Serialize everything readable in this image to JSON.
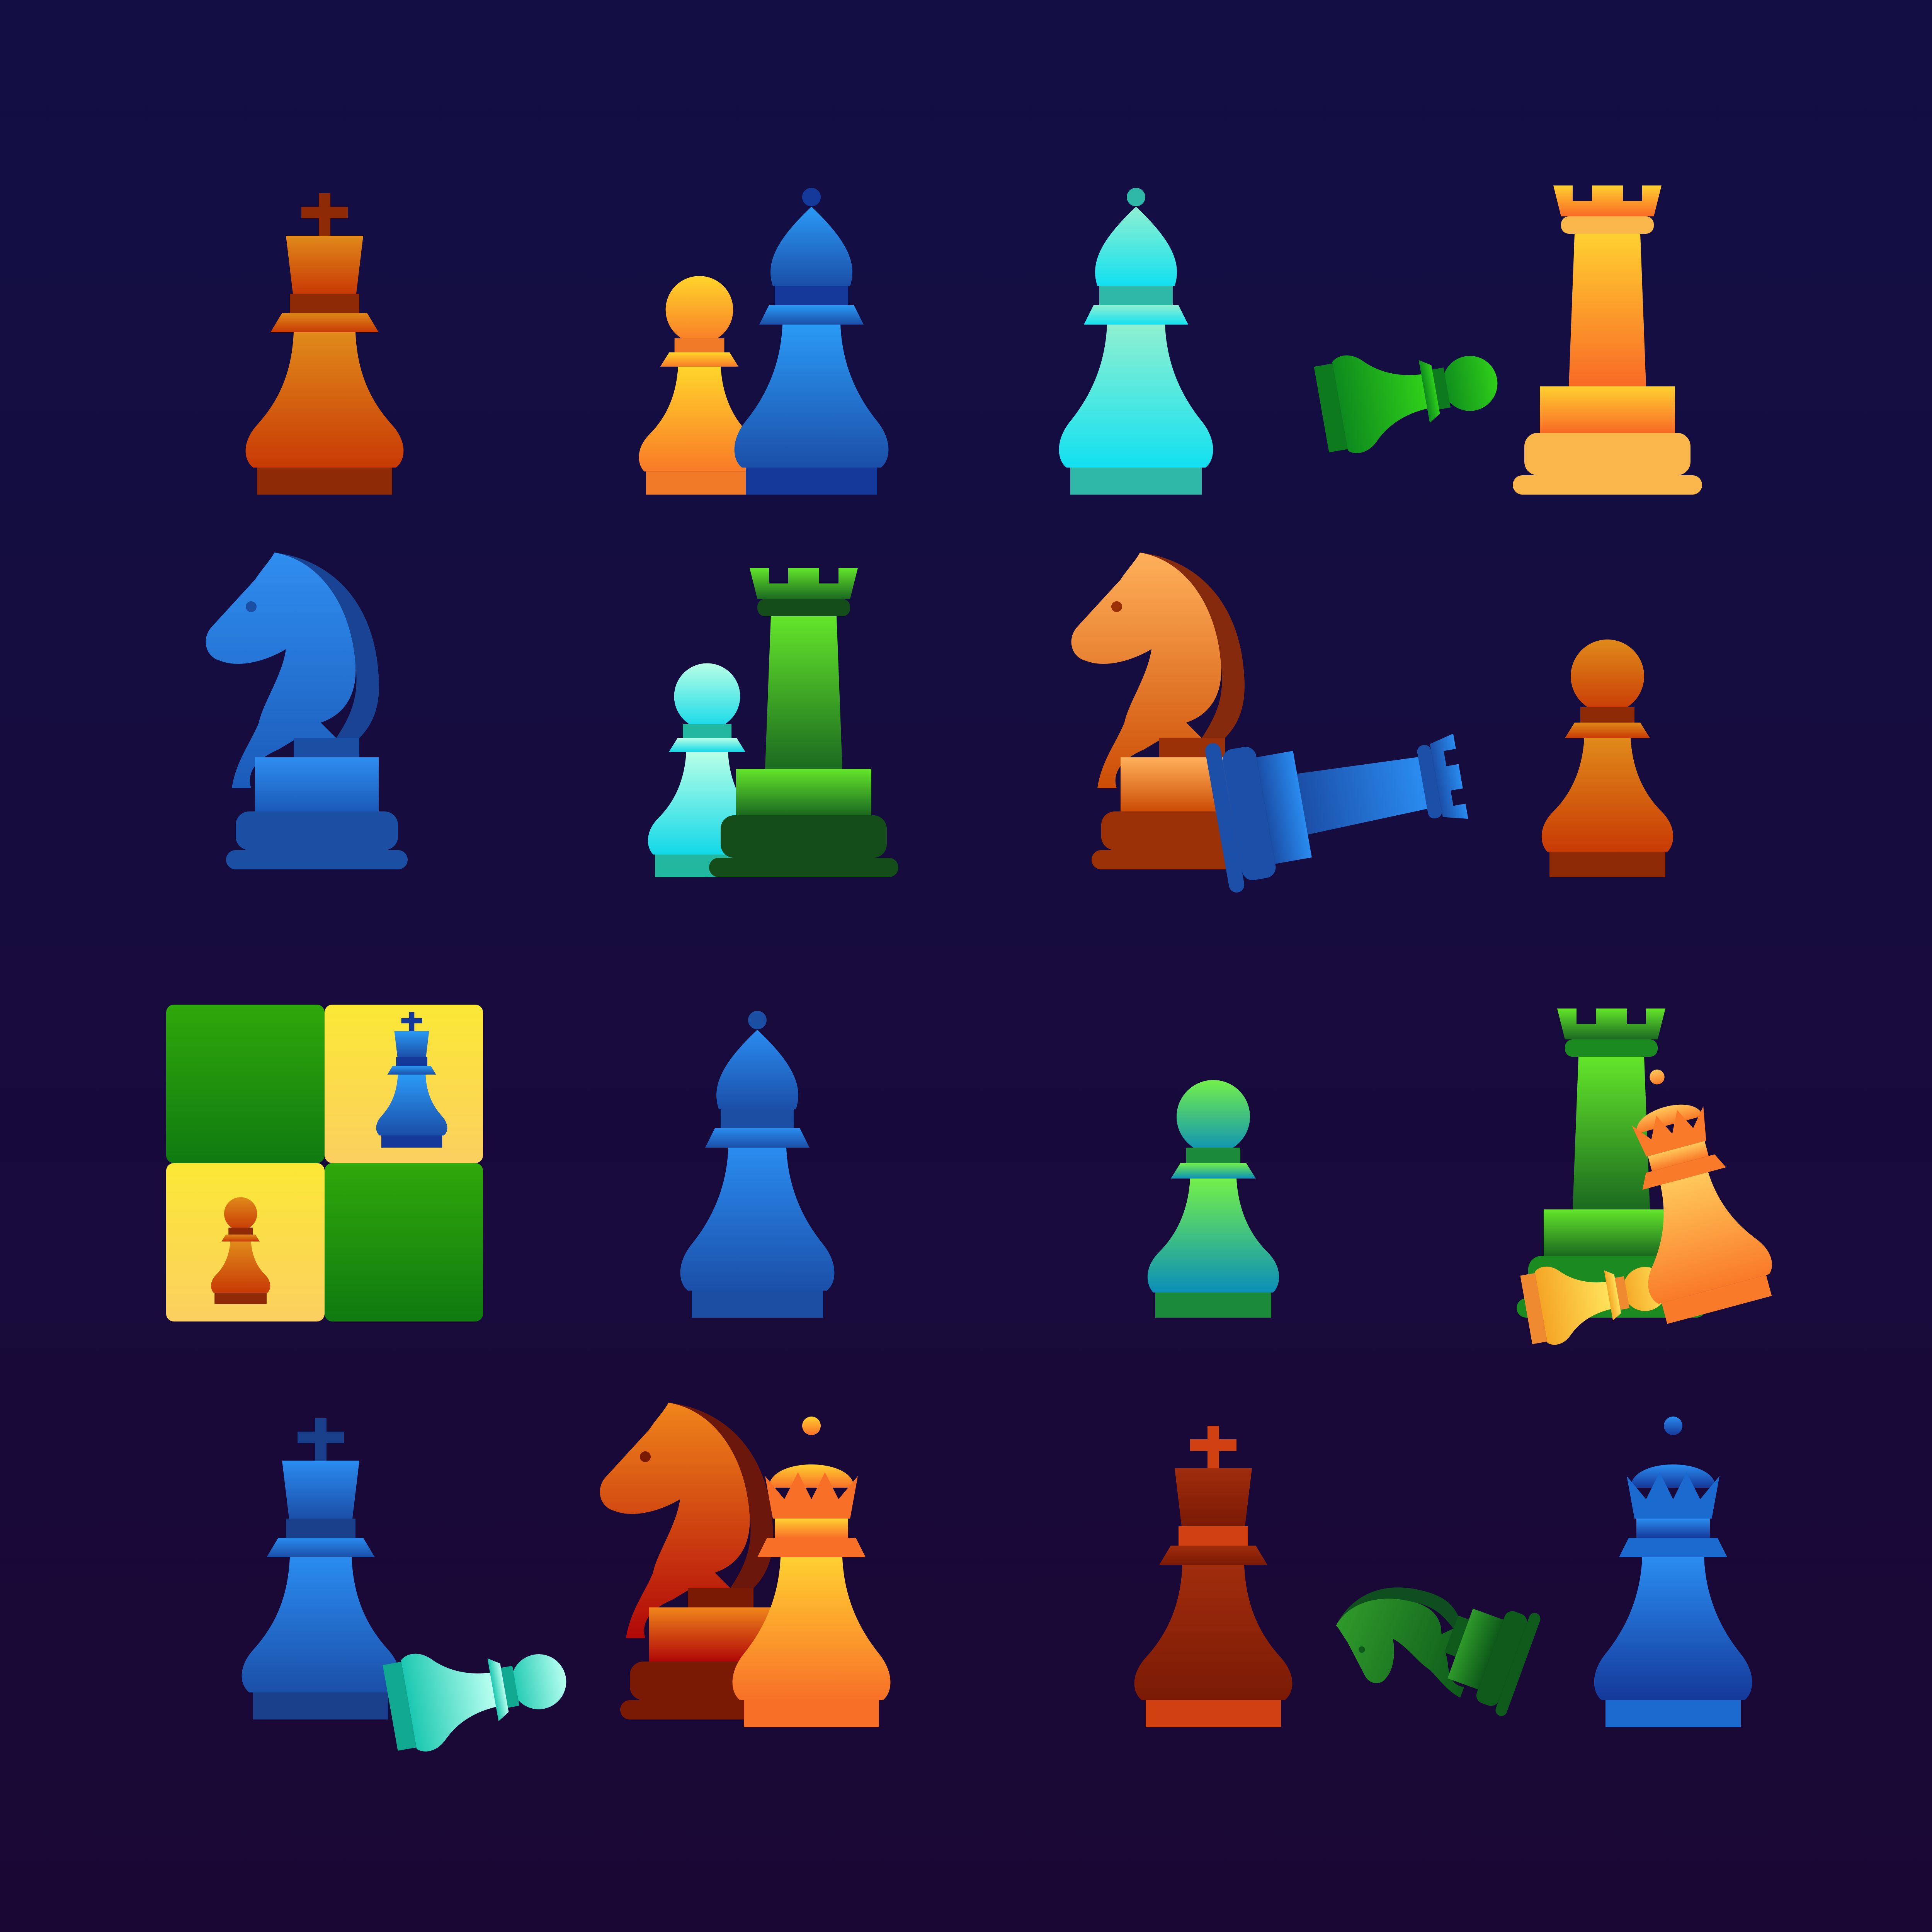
{
  "background": {
    "top": "#120f45",
    "bottom": "#1b0734"
  },
  "icons": [
    {
      "name": "king-icon",
      "pieces": [
        {
          "piece": "king",
          "colors": [
            "#e08a1a",
            "#c83a05"
          ],
          "base": "#8e2a05"
        }
      ]
    },
    {
      "name": "pawn-and-bishop-icon",
      "pieces": [
        {
          "piece": "pawn",
          "colors": [
            "#ffd52a",
            "#f97a28"
          ],
          "base": "#f07a28"
        },
        {
          "piece": "bishop",
          "colors": [
            "#2a9af5",
            "#1b4fa8"
          ],
          "base": "#14399a"
        }
      ]
    },
    {
      "name": "bishop-toppling-pawn-icon",
      "pieces": [
        {
          "piece": "bishop",
          "colors": [
            "#8ff0d0",
            "#12e0f0"
          ],
          "base": "#2fb8a8"
        },
        {
          "piece": "fallen-pawn",
          "colors": [
            "#2fcf1a",
            "#0e8a1e"
          ],
          "base": "#0e7a1e"
        }
      ]
    },
    {
      "name": "rook-icon",
      "pieces": [
        {
          "piece": "rook",
          "colors": [
            "#ffd030",
            "#f86a25"
          ],
          "base": "#f9b64a"
        }
      ]
    },
    {
      "name": "knight-icon",
      "pieces": [
        {
          "piece": "knight",
          "colors": [
            "#2f8ef0",
            "#1b5ab8"
          ],
          "base": "#1a4fa3"
        }
      ]
    },
    {
      "name": "pawn-and-rook-icon",
      "pieces": [
        {
          "piece": "pawn",
          "colors": [
            "#b8ffe6",
            "#12d8e8"
          ],
          "base": "#22b8a0"
        },
        {
          "piece": "rook",
          "colors": [
            "#63e52a",
            "#1b6a20"
          ],
          "base": "#144c1a"
        }
      ]
    },
    {
      "name": "knight-toppling-rook-icon",
      "pieces": [
        {
          "piece": "knight",
          "colors": [
            "#ffb05a",
            "#cc4d05"
          ],
          "base": "#9a3005"
        },
        {
          "piece": "fallen-rook",
          "colors": [
            "#2a8cf0",
            "#1b4fa8"
          ],
          "base": "#1b4fa8"
        }
      ]
    },
    {
      "name": "pawn-icon",
      "pieces": [
        {
          "piece": "pawn",
          "colors": [
            "#e08a1a",
            "#c83a05"
          ],
          "base": "#8e2a05"
        }
      ]
    },
    {
      "name": "chessboard-icon",
      "board": {
        "light": [
          "#fbe835",
          "#fbcf60"
        ],
        "dark": [
          "#2fa80a",
          "#0f7a10"
        ]
      },
      "pieces": [
        {
          "piece": "king",
          "colors": [
            "#2a9af5",
            "#1b4fa8"
          ],
          "base": "#14399a"
        },
        {
          "piece": "pawn",
          "colors": [
            "#e08a1a",
            "#c83a05"
          ],
          "base": "#8e2a05"
        }
      ]
    },
    {
      "name": "bishop-icon",
      "pieces": [
        {
          "piece": "bishop",
          "colors": [
            "#2a8cf0",
            "#1b4fa8"
          ],
          "base": "#1a4fa3"
        }
      ]
    },
    {
      "name": "pawn-icon",
      "pieces": [
        {
          "piece": "pawn",
          "colors": [
            "#74f04a",
            "#0b8fb8"
          ],
          "base": "#1b8a3a"
        }
      ]
    },
    {
      "name": "rook-and-fallen-pieces-icon",
      "pieces": [
        {
          "piece": "rook",
          "colors": [
            "#63e52a",
            "#1b6a20"
          ],
          "base": "#1b8a20"
        },
        {
          "piece": "fallen-pawn",
          "colors": [
            "#ffe25a",
            "#f5a525"
          ],
          "base": "#f08a30"
        },
        {
          "piece": "fallen-queen",
          "colors": [
            "#ffc85a",
            "#f97a28"
          ],
          "base": "#f97a28"
        }
      ]
    },
    {
      "name": "king-toppling-pawn-icon",
      "pieces": [
        {
          "piece": "king",
          "colors": [
            "#2a8cf0",
            "#1b4fa8"
          ],
          "base": "#1a3f8a"
        },
        {
          "piece": "fallen-pawn",
          "colors": [
            "#b8fff0",
            "#1cc8b0"
          ],
          "base": "#10a890"
        }
      ]
    },
    {
      "name": "knight-and-queen-icon",
      "pieces": [
        {
          "piece": "knight",
          "colors": [
            "#f0851a",
            "#b00808"
          ],
          "base": "#7a1a05"
        },
        {
          "piece": "queen",
          "colors": [
            "#ffd030",
            "#f87028"
          ],
          "base": "#f87028"
        }
      ]
    },
    {
      "name": "king-icon",
      "pieces": [
        {
          "piece": "king",
          "colors": [
            "#a02d0c",
            "#7a1a05"
          ],
          "base": "#d04010"
        }
      ]
    },
    {
      "name": "queen-and-fallen-knight-icon",
      "pieces": [
        {
          "piece": "queen",
          "colors": [
            "#2a8cf0",
            "#14399a"
          ],
          "base": "#1b6ad0"
        },
        {
          "piece": "fallen-knight",
          "colors": [
            "#2f9a2a",
            "#0e5a1a"
          ],
          "base": "#0e5a1a"
        }
      ]
    }
  ]
}
